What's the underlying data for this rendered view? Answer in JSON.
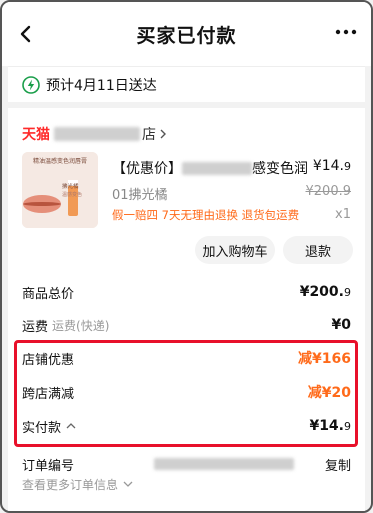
{
  "header": {
    "title": "买家已付款"
  },
  "delivery": {
    "text": "预计4月11日送达"
  },
  "store": {
    "logo": "天猫",
    "name_suffix": "店"
  },
  "product": {
    "thumb_text": "精油温感变色润唇膏",
    "thumb_sub": "拂光橘",
    "thumb_tag": "温感变色",
    "title_prefix": "【优惠价】",
    "title_suffix": "感变色润",
    "price": "¥14.",
    "price_dec": "9",
    "variant": "01拂光橘",
    "orig_price": "¥200.9",
    "tags": "假一赔四  7天无理由退换  退货包运费",
    "qty": "x1"
  },
  "actions": {
    "add_cart": "加入购物车",
    "refund": "退款"
  },
  "summary": {
    "total_label": "商品总价",
    "total_value": "¥200.",
    "total_dec": "9",
    "shipping_label": "运费",
    "shipping_sub": "运费(快递)",
    "shipping_value": "¥0",
    "store_discount_label": "店铺优惠",
    "store_discount_value": "减¥166",
    "cross_label": "跨店满减",
    "cross_value": "减¥20",
    "paid_label": "实付款",
    "paid_value": "¥14.",
    "paid_dec": "9"
  },
  "order": {
    "id_label": "订单编号",
    "copy": "复制",
    "more": "查看更多订单信息"
  },
  "colors": {
    "accent": "#ff6a1a",
    "highlight": "#e8102a",
    "tmall": "#ff2a2a"
  }
}
